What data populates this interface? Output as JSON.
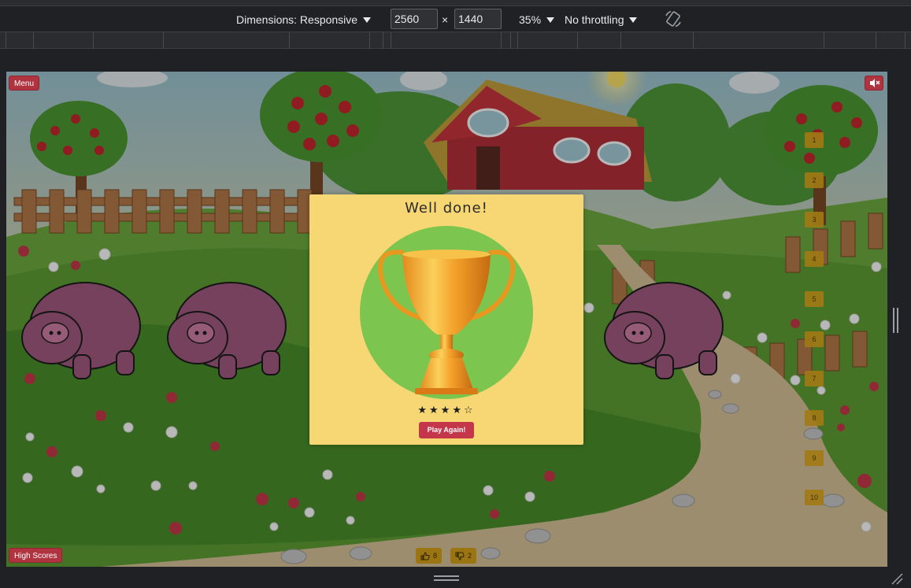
{
  "toolbar": {
    "dimensions_label": "Dimensions: Responsive",
    "width_value": "2560",
    "times": "×",
    "height_value": "1440",
    "zoom": "35%",
    "throttling": "No throttling",
    "rotate_icon": "rotate-icon"
  },
  "game": {
    "menu_label": "Menu",
    "mute_icon": "speaker-mute-icon",
    "high_scores_label": "High Scores",
    "levels": [
      "1",
      "2",
      "3",
      "4",
      "5",
      "6",
      "7",
      "8",
      "9",
      "10"
    ],
    "likes": "8",
    "dislikes": "2",
    "like_icon": "thumbs-up-icon",
    "dislike_icon": "thumbs-down-icon"
  },
  "modal": {
    "title": "Well done!",
    "rating": 4,
    "rating_max": 5,
    "stars_text": "★★★★☆",
    "play_again_label": "Play Again!"
  },
  "colors": {
    "modal_bg": "#f7d774",
    "trophy_circle": "#7cc650",
    "button_red": "#c4364a",
    "level_gold": "#a27a14",
    "devtools_bg": "#202124"
  }
}
